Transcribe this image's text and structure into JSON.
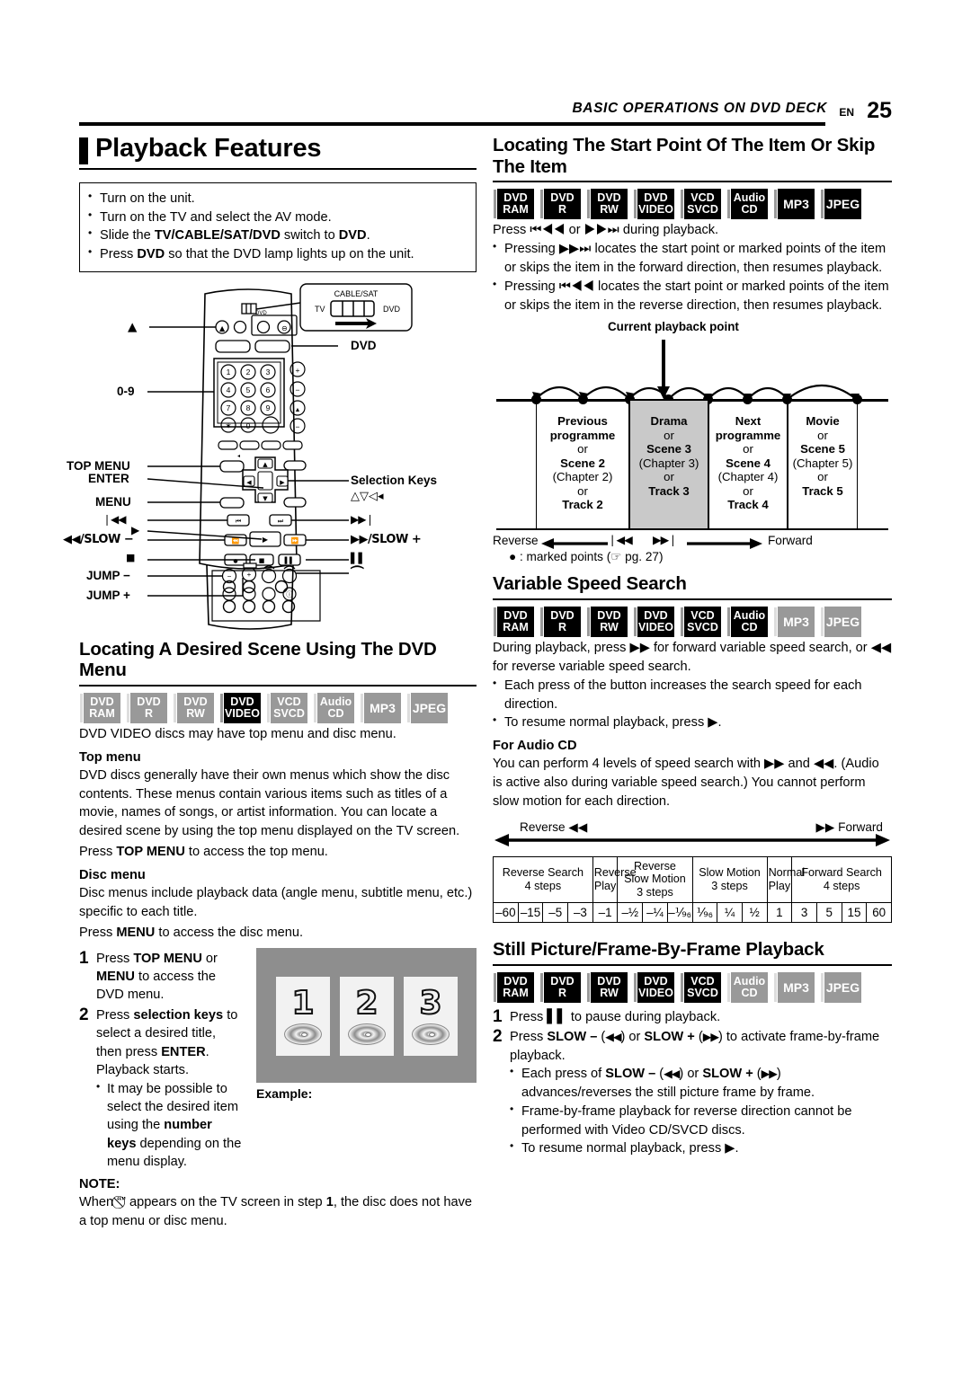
{
  "header": {
    "running_title": "BASIC OPERATIONS ON DVD DECK",
    "lang": "EN",
    "page_number": "25"
  },
  "left": {
    "page_title": "Playback Features",
    "intro_bullets": [
      "Turn on the unit.",
      "Turn on the TV and select the AV mode.",
      "Slide the TV/CABLE/SAT/DVD switch to DVD.",
      "Press DVD so that the DVD lamp lights up on the unit."
    ],
    "remote": {
      "switch_box": {
        "top": "CABLE/SAT",
        "left": "TV",
        "right": "DVD"
      },
      "labels_left": [
        "▲",
        "0-9",
        "TOP MENU",
        "ENTER",
        "MENU",
        "⏮◀◀",
        "▶",
        "◀◀/SLOW –",
        "■",
        "JUMP –",
        "JUMP +"
      ],
      "labels_right": [
        "DVD",
        "Selection Keys",
        "△▽◁▷",
        "▶▶⏭",
        "▶▶/SLOW +",
        "Ⅱ",
        "⌒"
      ],
      "keypad": [
        "1",
        "2",
        "3",
        "4",
        "5",
        "6",
        "7",
        "8",
        "9",
        "✲",
        "0"
      ]
    },
    "dvd_menu": {
      "title": "Locating A Desired Scene Using The DVD Menu",
      "badges": [
        {
          "l1": "DVD",
          "l2": "RAM",
          "on": false
        },
        {
          "l1": "DVD",
          "l2": "R",
          "on": false
        },
        {
          "l1": "DVD",
          "l2": "RW",
          "on": false
        },
        {
          "l1": "DVD",
          "l2": "VIDEO",
          "on": true
        },
        {
          "l1": "VCD",
          "l2": "SVCD",
          "on": false
        },
        {
          "l1": "Audio",
          "l2": "CD",
          "on": false
        },
        {
          "l1": "MP3",
          "l2": "",
          "on": false
        },
        {
          "l1": "JPEG",
          "l2": "",
          "on": false
        }
      ],
      "intro": "DVD VIDEO discs may have top menu and disc menu.",
      "top_menu_head": "Top menu",
      "top_menu_body_1": "DVD discs generally have their own menus which show the disc contents. These menus contain various items such as titles of a movie, names of songs, or artist information. You can locate a desired scene by using the top menu displayed on the TV screen.",
      "top_menu_body_2_pre": "Press ",
      "top_menu_body_2_b": "TOP MENU",
      "top_menu_body_2_post": " to access the top menu.",
      "disc_menu_head": "Disc menu",
      "disc_menu_body_1": "Disc menus include playback data (angle menu, subtitle menu, etc.) specific to each title.",
      "disc_menu_body_2_pre": "Press ",
      "disc_menu_body_2_b": "MENU",
      "disc_menu_body_2_post": " to access the disc menu.",
      "step1_n": "1",
      "step1_text": "Press TOP MENU or MENU to access the DVD menu.",
      "step2_n": "2",
      "step2_text": "Press selection keys to select a desired title, then press ENTER. Playback starts.",
      "step2_sub": "It may be possible to select the desired item using the number keys depending on the menu display.",
      "example_label": "Example:",
      "tv_cards": [
        "1",
        "2",
        "3"
      ],
      "note_head": "NOTE:",
      "note_body": "When “⃠” appears on the TV screen in step 1, the disc does not have a top menu or disc menu."
    }
  },
  "right": {
    "locate": {
      "title": "Locating The Start Point Of The Item Or Skip The Item",
      "badges": [
        {
          "l1": "DVD",
          "l2": "RAM",
          "on": true
        },
        {
          "l1": "DVD",
          "l2": "R",
          "on": true
        },
        {
          "l1": "DVD",
          "l2": "RW",
          "on": true
        },
        {
          "l1": "DVD",
          "l2": "VIDEO",
          "on": true
        },
        {
          "l1": "VCD",
          "l2": "SVCD",
          "on": true
        },
        {
          "l1": "Audio",
          "l2": "CD",
          "on": true
        },
        {
          "l1": "MP3",
          "l2": "",
          "on": true
        },
        {
          "l1": "JPEG",
          "l2": "",
          "on": true
        }
      ],
      "lead": "Press ⏮◀◀ or ▶▶⏭ during playback.",
      "bullets": [
        "Pressing ▶▶⏭ locates the start point or marked points of the item or skips the item in the forward direction, then resumes playback.",
        "Pressing ⏮◀◀ locates the start point or marked points of the item or skips the item in the reverse direction, then resumes playback."
      ],
      "diagram": {
        "caption": "Current playback point",
        "segments": [
          {
            "lines": [
              "Previous",
              "programme",
              "or",
              "Scene 2",
              "(Chapter 2)",
              "or",
              "Track 2"
            ],
            "bold": [
              true,
              true,
              false,
              true,
              false,
              false,
              true
            ],
            "highlight": false
          },
          {
            "lines": [
              "Drama",
              "or",
              "Scene 3",
              "(Chapter 3)",
              "or",
              "Track 3"
            ],
            "bold": [
              true,
              false,
              true,
              false,
              false,
              true
            ],
            "highlight": true
          },
          {
            "lines": [
              "Next",
              "programme",
              "or",
              "Scene 4",
              "(Chapter 4)",
              "or",
              "Track 4"
            ],
            "bold": [
              true,
              true,
              false,
              true,
              false,
              false,
              true
            ],
            "highlight": false
          },
          {
            "lines": [
              "Movie",
              "or",
              "Scene 5",
              "(Chapter 5)",
              "or",
              "Track 5"
            ],
            "bold": [
              true,
              false,
              true,
              false,
              false,
              true
            ],
            "highlight": false
          }
        ],
        "reverse_label": "Reverse",
        "forward_label": "Forward",
        "marked_note": "● : marked points (☞ pg. 27)"
      }
    },
    "variable": {
      "title": "Variable Speed Search",
      "badges": [
        {
          "l1": "DVD",
          "l2": "RAM",
          "on": true
        },
        {
          "l1": "DVD",
          "l2": "R",
          "on": true
        },
        {
          "l1": "DVD",
          "l2": "RW",
          "on": true
        },
        {
          "l1": "DVD",
          "l2": "VIDEO",
          "on": true
        },
        {
          "l1": "VCD",
          "l2": "SVCD",
          "on": true
        },
        {
          "l1": "Audio",
          "l2": "CD",
          "on": true
        },
        {
          "l1": "MP3",
          "l2": "",
          "on": false
        },
        {
          "l1": "JPEG",
          "l2": "",
          "on": false
        }
      ],
      "lead": "During playback, press ▶▶ for forward variable speed search, or ◀◀ for reverse variable speed search.",
      "bullets": [
        "Each press of the button increases the search speed for each direction.",
        "To resume normal playback, press ▶."
      ],
      "audio_head": "For Audio CD",
      "audio_body": "You can perform 4 levels of speed search with ▶▶ and ◀◀. (Audio is active also during variable speed search.) You cannot perform slow motion for each direction.",
      "table_reverse": "Reverse ◀◀",
      "table_forward": "▶▶ Forward"
    },
    "still": {
      "title": "Still Picture/Frame-By-Frame Playback",
      "badges": [
        {
          "l1": "DVD",
          "l2": "RAM",
          "on": true
        },
        {
          "l1": "DVD",
          "l2": "R",
          "on": true
        },
        {
          "l1": "DVD",
          "l2": "RW",
          "on": true
        },
        {
          "l1": "DVD",
          "l2": "VIDEO",
          "on": true
        },
        {
          "l1": "VCD",
          "l2": "SVCD",
          "on": true
        },
        {
          "l1": "Audio",
          "l2": "CD",
          "on": false
        },
        {
          "l1": "MP3",
          "l2": "",
          "on": false
        },
        {
          "l1": "JPEG",
          "l2": "",
          "on": false
        }
      ],
      "step1_n": "1",
      "step1_text": "Press Ⅱ to pause during playback.",
      "step2_n": "2",
      "step2_text": "Press SLOW – (◀◀) or SLOW + (▶▶) to activate frame-by-frame playback.",
      "bullets": [
        "Each press of SLOW – (◀◀) or SLOW + (▶▶) advances/reverses the still picture frame by frame.",
        "Frame-by-frame playback for reverse direction cannot be performed with Video CD/SVCD discs.",
        "To resume normal playback, press ▶."
      ]
    }
  },
  "chart_data": {
    "type": "table",
    "title": "Variable speed search steps",
    "group_headers": [
      {
        "label": "Reverse Search\n4 steps",
        "span": 4
      },
      {
        "label": "Reverse\nPlay",
        "span": 1
      },
      {
        "label": "Reverse\nSlow Motion\n3 steps",
        "span": 3
      },
      {
        "label": "Slow Motion\n3 steps",
        "span": 3
      },
      {
        "label": "Normal\nPlay",
        "span": 1
      },
      {
        "label": "Forward Search\n4 steps",
        "span": 4
      }
    ],
    "values": [
      "–60",
      "–15",
      "–5",
      "–3",
      "–1",
      "–½",
      "–¼",
      "–⅑₆",
      "⅑₆",
      "¼",
      "½",
      "1",
      "3",
      "5",
      "15",
      "60"
    ],
    "axis_left": "Reverse ◀◀",
    "axis_right": "▶▶ Forward"
  }
}
